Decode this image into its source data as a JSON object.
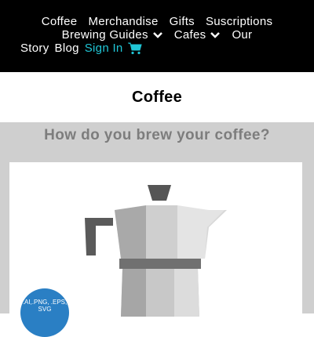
{
  "nav": {
    "items": [
      {
        "label": "Coffee"
      },
      {
        "label": "Merchandise"
      },
      {
        "label": "Gifts"
      },
      {
        "label": "Suscriptions"
      },
      {
        "label": "Brewing Guides"
      },
      {
        "label": "Cafes"
      },
      {
        "label": "Our"
      },
      {
        "label": "Story"
      },
      {
        "label": "Blog"
      },
      {
        "label": "Sign In"
      }
    ],
    "signin_color": "#20c6d6"
  },
  "page": {
    "title": "Coffee",
    "question": "How do you brew your coffee?"
  },
  "card": {
    "badge_text": ".AI,.PNG, .EPS, SVG"
  }
}
